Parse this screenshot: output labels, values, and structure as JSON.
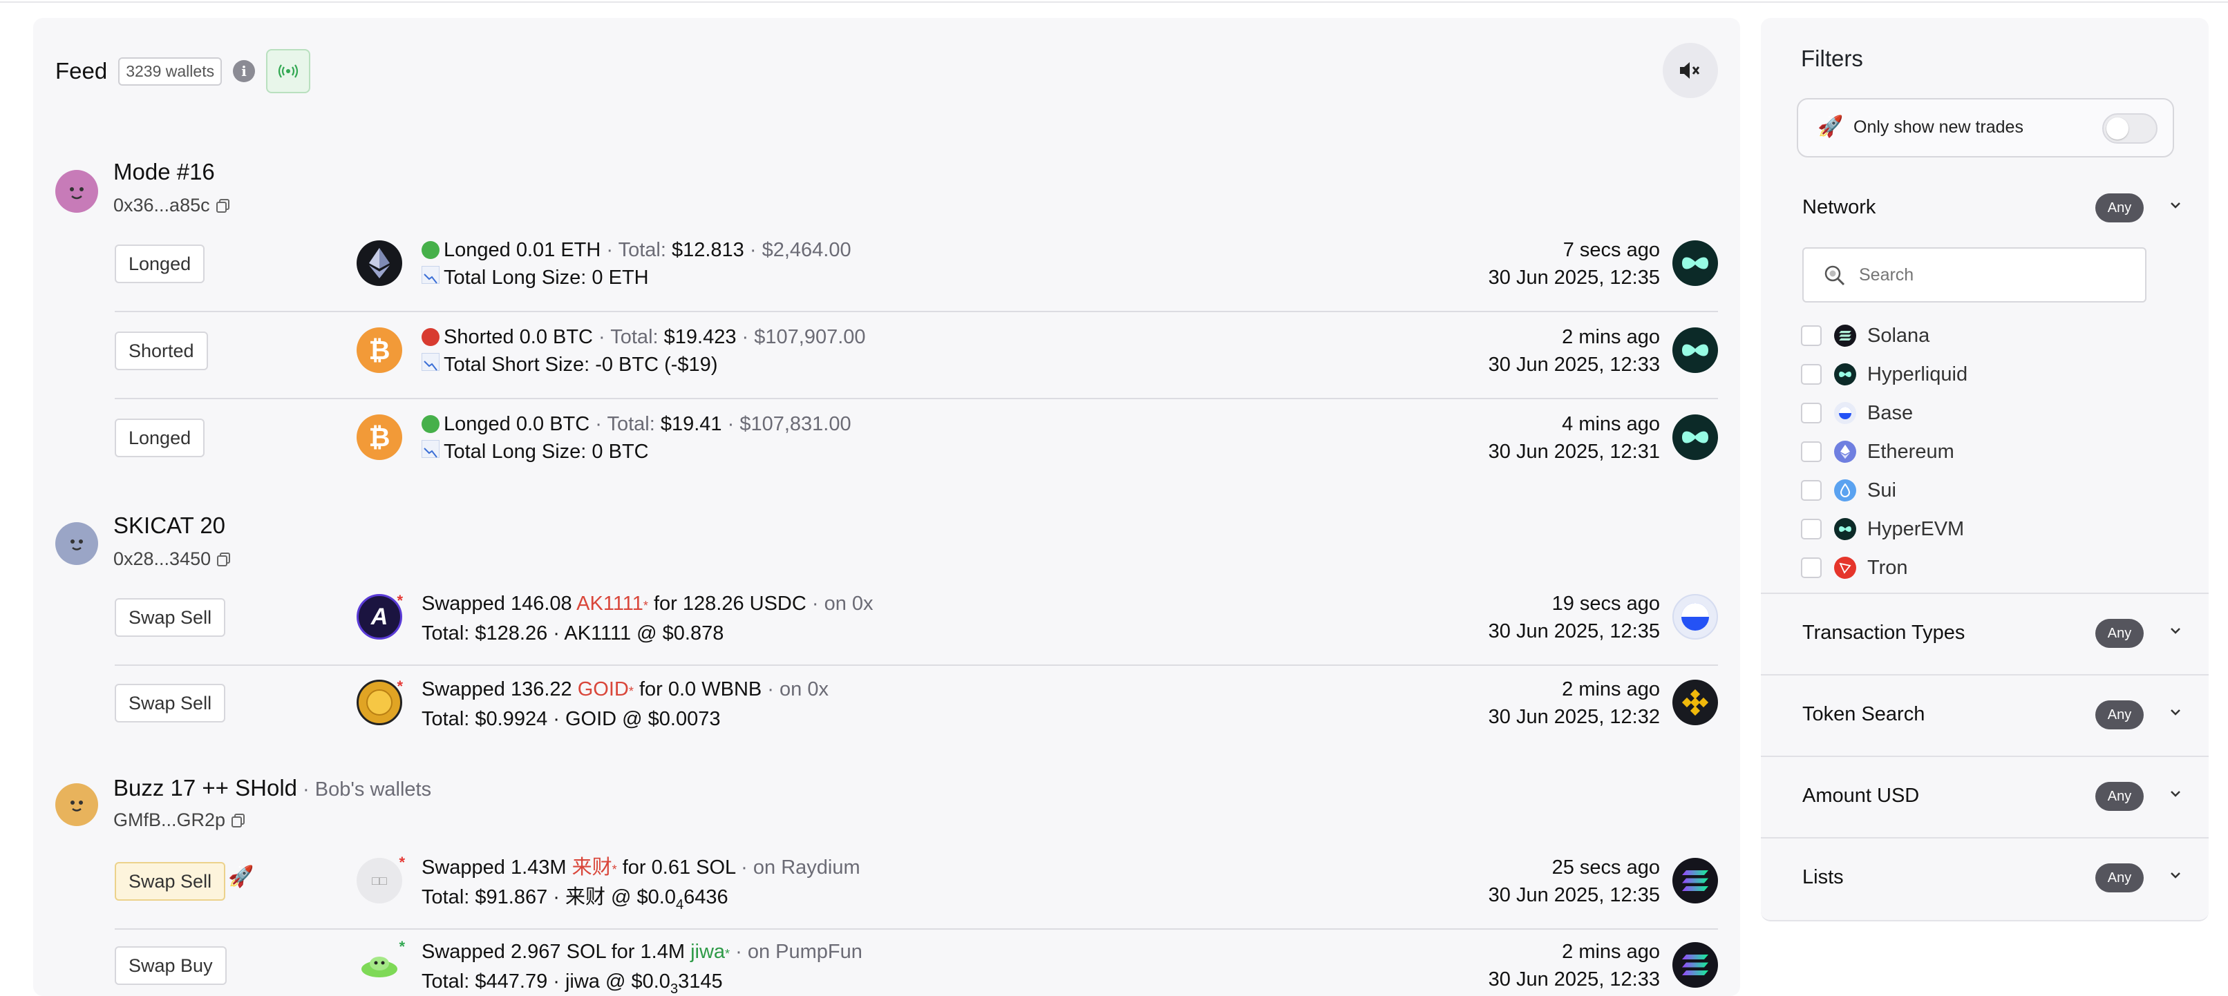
{
  "feed": {
    "title": "Feed",
    "wallet_count": "3239 wallets",
    "info_icon": "i"
  },
  "groups": [
    {
      "name": "Mode #16",
      "sub": "",
      "address": "0x36...a85c",
      "trades": [
        {
          "tag": "Longed",
          "token_icon": "ethereum-token-icon",
          "main": "Longed 0.01 ETH",
          "total_label": "Total:",
          "total": "$12.813",
          "price": "$2,464.00",
          "line2": "Total Long Size: 0 ETH",
          "ago": "7 secs ago",
          "date": "30 Jun 2025, 12:35",
          "chain": "hyperliquid"
        },
        {
          "tag": "Shorted",
          "token_icon": "bitcoin-token-icon",
          "main": "Shorted 0.0 BTC",
          "total_label": "Total:",
          "total": "$19.423",
          "price": "$107,907.00",
          "line2": "Total Short Size: -0 BTC (-$19)",
          "ago": "2 mins ago",
          "date": "30 Jun 2025, 12:33",
          "chain": "hyperliquid"
        },
        {
          "tag": "Longed",
          "token_icon": "bitcoin-token-icon",
          "main": "Longed 0.0 BTC",
          "total_label": "Total:",
          "total": "$19.41",
          "price": "$107,831.00",
          "line2": "Total Long Size: 0 BTC",
          "ago": "4 mins ago",
          "date": "30 Jun 2025, 12:31",
          "chain": "hyperliquid"
        }
      ]
    },
    {
      "name": "SKICAT 20",
      "sub": "",
      "address": "0x28...3450",
      "trades": [
        {
          "tag": "Swap Sell",
          "prefix": "Swapped 146.08",
          "token": "AK1111",
          "suffix": "for 128.26 USDC",
          "venue": "on 0x",
          "line2": "Total: $128.26 · AK1111 @ $0.878",
          "ago": "19 secs ago",
          "date": "30 Jun 2025, 12:35",
          "chain": "base"
        },
        {
          "tag": "Swap Sell",
          "prefix": "Swapped 136.22",
          "token": "GOID",
          "suffix": "for 0.0 WBNB",
          "venue": "on 0x",
          "line2": "Total: $0.9924 · GOID @ $0.0073",
          "ago": "2 mins ago",
          "date": "30 Jun 2025, 12:32",
          "chain": "bnb"
        }
      ]
    },
    {
      "name": "Buzz 17 ++ SHold",
      "sub": "Bob's wallets",
      "address": "GMfB...GR2p",
      "trades": [
        {
          "tag": "Swap Sell",
          "prefix": "Swapped 1.43M",
          "token": "来财",
          "suffix": "for 0.61 SOL",
          "venue": "on Raydium",
          "line2_a": "Total: $91.867 · 来财 @ $0.0",
          "line2_sub": "4",
          "line2_b": "6436",
          "ago": "25 secs ago",
          "date": "30 Jun 2025, 12:35",
          "chain": "solana"
        },
        {
          "tag": "Swap Buy",
          "prefix": "Swapped 2.967 SOL for 1.4M",
          "token": "jiwa",
          "suffix": "",
          "venue": "on PumpFun",
          "line2_a": "Total: $447.79 · jiwa @ $0.0",
          "line2_sub": "3",
          "line2_b": "3145",
          "ago": "2 mins ago",
          "date": "30 Jun 2025, 12:33",
          "chain": "solana"
        }
      ]
    }
  ],
  "filters": {
    "title": "Filters",
    "new_trades_label": "Only show new trades",
    "network_title": "Network",
    "any": "Any",
    "search_placeholder": "Search",
    "networks": [
      "Solana",
      "Hyperliquid",
      "Base",
      "Ethereum",
      "Sui",
      "HyperEVM",
      "Tron"
    ],
    "sections": [
      "Transaction Types",
      "Token Search",
      "Amount USD",
      "Lists"
    ]
  },
  "colors": {
    "accent_green": "#2e9a47",
    "accent_red": "#d9463a",
    "badge_dark": "#55555d"
  }
}
